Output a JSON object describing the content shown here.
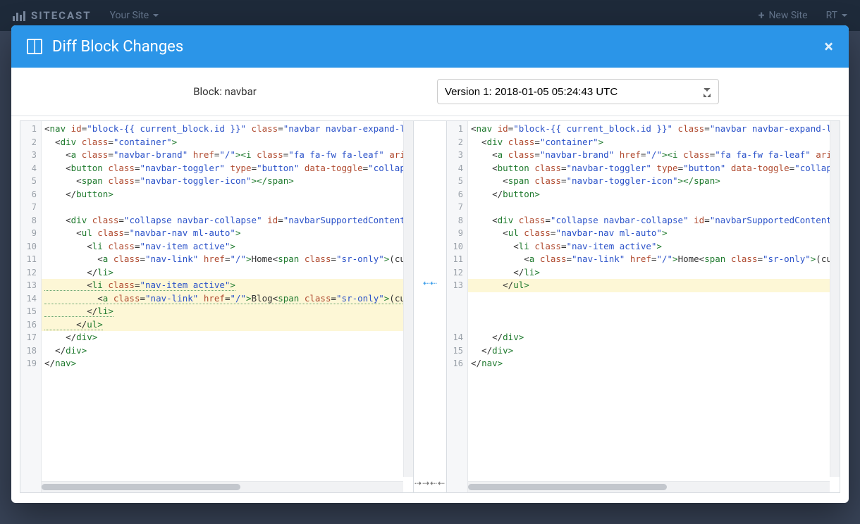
{
  "appbar": {
    "brand": "SITECAST",
    "your_site": "Your Site",
    "new_site": "New Site",
    "user": "RT"
  },
  "modal": {
    "title": "Diff Block Changes",
    "block_label": "Block: navbar",
    "version_selected": "Version 1: 2018-01-05 05:24:43 UTC"
  },
  "connector": {
    "mid": "⇠⇠",
    "bottom": "⇢⇢⇠⇠"
  },
  "left": {
    "lines": [
      {
        "n": "1",
        "hl": "",
        "tokens": [
          [
            "",
            "<"
          ],
          [
            "tag",
            "nav "
          ],
          [
            "attr",
            "id"
          ],
          [
            "",
            "="
          ],
          [
            "val",
            "\"block-{{ current_block.id }}\""
          ],
          [
            "",
            " "
          ],
          [
            "attr",
            "class"
          ],
          [
            "",
            "="
          ],
          [
            "val",
            "\"navbar navbar-expand-l"
          ]
        ]
      },
      {
        "n": "2",
        "hl": "",
        "tokens": [
          [
            "",
            "  <"
          ],
          [
            "tag",
            "div "
          ],
          [
            "attr",
            "class"
          ],
          [
            "",
            "="
          ],
          [
            "val",
            "\"container\""
          ],
          [
            "tag",
            ">"
          ]
        ]
      },
      {
        "n": "3",
        "hl": "",
        "tokens": [
          [
            "",
            "    <"
          ],
          [
            "tag",
            "a "
          ],
          [
            "attr",
            "class"
          ],
          [
            "",
            "="
          ],
          [
            "val",
            "\"navbar-brand\""
          ],
          [
            "",
            " "
          ],
          [
            "attr",
            "href"
          ],
          [
            "",
            "="
          ],
          [
            "val",
            "\"/\""
          ],
          [
            "tag",
            "><"
          ],
          [
            "tag",
            "i "
          ],
          [
            "attr",
            "class"
          ],
          [
            "",
            "="
          ],
          [
            "val",
            "\"fa fa-fw fa-leaf\""
          ],
          [
            "",
            " "
          ],
          [
            "attr",
            "ari"
          ]
        ]
      },
      {
        "n": "4",
        "hl": "",
        "tokens": [
          [
            "",
            "    <"
          ],
          [
            "tag",
            "button "
          ],
          [
            "attr",
            "class"
          ],
          [
            "",
            "="
          ],
          [
            "val",
            "\"navbar-toggler\""
          ],
          [
            "",
            " "
          ],
          [
            "attr",
            "type"
          ],
          [
            "",
            "="
          ],
          [
            "val",
            "\"button\""
          ],
          [
            "",
            " "
          ],
          [
            "attr",
            "data-toggle"
          ],
          [
            "",
            "="
          ],
          [
            "val",
            "\"collap"
          ]
        ]
      },
      {
        "n": "5",
        "hl": "",
        "tokens": [
          [
            "",
            "      <"
          ],
          [
            "tag",
            "span "
          ],
          [
            "attr",
            "class"
          ],
          [
            "",
            "="
          ],
          [
            "val",
            "\"navbar-toggler-icon\""
          ],
          [
            "tag",
            "></"
          ],
          [
            "tag",
            "span"
          ],
          [
            "tag",
            ">"
          ]
        ]
      },
      {
        "n": "6",
        "hl": "",
        "tokens": [
          [
            "",
            "    </"
          ],
          [
            "tag",
            "button"
          ],
          [
            "tag",
            ">"
          ]
        ]
      },
      {
        "n": "7",
        "hl": "",
        "tokens": [
          [
            "",
            ""
          ]
        ]
      },
      {
        "n": "8",
        "hl": "",
        "tokens": [
          [
            "",
            "    <"
          ],
          [
            "tag",
            "div "
          ],
          [
            "attr",
            "class"
          ],
          [
            "",
            "="
          ],
          [
            "val",
            "\"collapse navbar-collapse\""
          ],
          [
            "",
            " "
          ],
          [
            "attr",
            "id"
          ],
          [
            "",
            "="
          ],
          [
            "val",
            "\"navbarSupportedContent"
          ]
        ]
      },
      {
        "n": "9",
        "hl": "",
        "tokens": [
          [
            "",
            "      <"
          ],
          [
            "tag",
            "ul "
          ],
          [
            "attr",
            "class"
          ],
          [
            "",
            "="
          ],
          [
            "val",
            "\"navbar-nav ml-auto\""
          ],
          [
            "tag",
            ">"
          ]
        ]
      },
      {
        "n": "10",
        "hl": "",
        "tokens": [
          [
            "",
            "        <"
          ],
          [
            "tag",
            "li "
          ],
          [
            "attr",
            "class"
          ],
          [
            "",
            "="
          ],
          [
            "val",
            "\"nav-item active\""
          ],
          [
            "tag",
            ">"
          ]
        ]
      },
      {
        "n": "11",
        "hl": "",
        "tokens": [
          [
            "",
            "          <"
          ],
          [
            "tag",
            "a "
          ],
          [
            "attr",
            "class"
          ],
          [
            "",
            "="
          ],
          [
            "val",
            "\"nav-link\""
          ],
          [
            "",
            " "
          ],
          [
            "attr",
            "href"
          ],
          [
            "",
            "="
          ],
          [
            "val",
            "\"/\""
          ],
          [
            "tag",
            ">"
          ],
          [
            "",
            "Home<"
          ],
          [
            "tag",
            "span "
          ],
          [
            "attr",
            "class"
          ],
          [
            "",
            "="
          ],
          [
            "val",
            "\"sr-only\""
          ],
          [
            "tag",
            ">"
          ],
          [
            "",
            "(cu"
          ]
        ]
      },
      {
        "n": "12",
        "hl": "",
        "tokens": [
          [
            "",
            "        </"
          ],
          [
            "tag",
            "li"
          ],
          [
            "tag",
            ">"
          ]
        ]
      },
      {
        "n": "13",
        "hl": "change",
        "ins": true,
        "tokens": [
          [
            "",
            "        <"
          ],
          [
            "tag",
            "li "
          ],
          [
            "attr",
            "class"
          ],
          [
            "",
            "="
          ],
          [
            "val",
            "\"nav-item active\""
          ],
          [
            "tag",
            ">"
          ]
        ]
      },
      {
        "n": "14",
        "hl": "change",
        "ins": true,
        "tokens": [
          [
            "",
            "          <"
          ],
          [
            "tag",
            "a "
          ],
          [
            "attr",
            "class"
          ],
          [
            "",
            "="
          ],
          [
            "val",
            "\"nav-link\""
          ],
          [
            "",
            " "
          ],
          [
            "attr",
            "href"
          ],
          [
            "",
            "="
          ],
          [
            "val",
            "\"/\""
          ],
          [
            "tag",
            ">"
          ],
          [
            "",
            "Blog<"
          ],
          [
            "tag",
            "span "
          ],
          [
            "attr",
            "class"
          ],
          [
            "",
            "="
          ],
          [
            "val",
            "\"sr-only\""
          ],
          [
            "tag",
            ">"
          ],
          [
            "",
            "(cu"
          ]
        ]
      },
      {
        "n": "15",
        "hl": "change",
        "ins": true,
        "tokens": [
          [
            "",
            "        </"
          ],
          [
            "tag",
            "li"
          ],
          [
            "tag",
            ">"
          ]
        ]
      },
      {
        "n": "16",
        "hl": "change",
        "ins": true,
        "tokens": [
          [
            "",
            "      </"
          ],
          [
            "tag",
            "ul"
          ],
          [
            "tag",
            ">"
          ]
        ]
      },
      {
        "n": "17",
        "hl": "",
        "tokens": [
          [
            "",
            "    </"
          ],
          [
            "tag",
            "div"
          ],
          [
            "tag",
            ">"
          ]
        ]
      },
      {
        "n": "18",
        "hl": "",
        "tokens": [
          [
            "",
            "  </"
          ],
          [
            "tag",
            "div"
          ],
          [
            "tag",
            ">"
          ]
        ]
      },
      {
        "n": "19",
        "hl": "",
        "tokens": [
          [
            "",
            "</"
          ],
          [
            "tag",
            "nav"
          ],
          [
            "tag",
            ">"
          ]
        ]
      }
    ],
    "thumb_left": 0,
    "thumb_width": 55
  },
  "right": {
    "lines": [
      {
        "n": "1",
        "hl": "",
        "tokens": [
          [
            "",
            "<"
          ],
          [
            "tag",
            "nav "
          ],
          [
            "attr",
            "id"
          ],
          [
            "",
            "="
          ],
          [
            "val",
            "\"block-{{ current_block.id }}\""
          ],
          [
            "",
            " "
          ],
          [
            "attr",
            "class"
          ],
          [
            "",
            "="
          ],
          [
            "val",
            "\"navbar navbar-expand-l"
          ]
        ]
      },
      {
        "n": "2",
        "hl": "",
        "tokens": [
          [
            "",
            "  <"
          ],
          [
            "tag",
            "div "
          ],
          [
            "attr",
            "class"
          ],
          [
            "",
            "="
          ],
          [
            "val",
            "\"container\""
          ],
          [
            "tag",
            ">"
          ]
        ]
      },
      {
        "n": "3",
        "hl": "",
        "tokens": [
          [
            "",
            "    <"
          ],
          [
            "tag",
            "a "
          ],
          [
            "attr",
            "class"
          ],
          [
            "",
            "="
          ],
          [
            "val",
            "\"navbar-brand\""
          ],
          [
            "",
            " "
          ],
          [
            "attr",
            "href"
          ],
          [
            "",
            "="
          ],
          [
            "val",
            "\"/\""
          ],
          [
            "tag",
            "><"
          ],
          [
            "tag",
            "i "
          ],
          [
            "attr",
            "class"
          ],
          [
            "",
            "="
          ],
          [
            "val",
            "\"fa fa-fw fa-leaf\""
          ],
          [
            "",
            " "
          ],
          [
            "attr",
            "ari"
          ]
        ]
      },
      {
        "n": "4",
        "hl": "",
        "tokens": [
          [
            "",
            "    <"
          ],
          [
            "tag",
            "button "
          ],
          [
            "attr",
            "class"
          ],
          [
            "",
            "="
          ],
          [
            "val",
            "\"navbar-toggler\""
          ],
          [
            "",
            " "
          ],
          [
            "attr",
            "type"
          ],
          [
            "",
            "="
          ],
          [
            "val",
            "\"button\""
          ],
          [
            "",
            " "
          ],
          [
            "attr",
            "data-toggle"
          ],
          [
            "",
            "="
          ],
          [
            "val",
            "\"collap"
          ]
        ]
      },
      {
        "n": "5",
        "hl": "",
        "tokens": [
          [
            "",
            "      <"
          ],
          [
            "tag",
            "span "
          ],
          [
            "attr",
            "class"
          ],
          [
            "",
            "="
          ],
          [
            "val",
            "\"navbar-toggler-icon\""
          ],
          [
            "tag",
            "></"
          ],
          [
            "tag",
            "span"
          ],
          [
            "tag",
            ">"
          ]
        ]
      },
      {
        "n": "6",
        "hl": "",
        "tokens": [
          [
            "",
            "    </"
          ],
          [
            "tag",
            "button"
          ],
          [
            "tag",
            ">"
          ]
        ]
      },
      {
        "n": "7",
        "hl": "",
        "tokens": [
          [
            "",
            ""
          ]
        ]
      },
      {
        "n": "8",
        "hl": "",
        "tokens": [
          [
            "",
            "    <"
          ],
          [
            "tag",
            "div "
          ],
          [
            "attr",
            "class"
          ],
          [
            "",
            "="
          ],
          [
            "val",
            "\"collapse navbar-collapse\""
          ],
          [
            "",
            " "
          ],
          [
            "attr",
            "id"
          ],
          [
            "",
            "="
          ],
          [
            "val",
            "\"navbarSupportedContent"
          ]
        ]
      },
      {
        "n": "9",
        "hl": "",
        "tokens": [
          [
            "",
            "      <"
          ],
          [
            "tag",
            "ul "
          ],
          [
            "attr",
            "class"
          ],
          [
            "",
            "="
          ],
          [
            "val",
            "\"navbar-nav ml-auto\""
          ],
          [
            "tag",
            ">"
          ]
        ]
      },
      {
        "n": "10",
        "hl": "",
        "tokens": [
          [
            "",
            "        <"
          ],
          [
            "tag",
            "li "
          ],
          [
            "attr",
            "class"
          ],
          [
            "",
            "="
          ],
          [
            "val",
            "\"nav-item active\""
          ],
          [
            "tag",
            ">"
          ]
        ]
      },
      {
        "n": "11",
        "hl": "",
        "tokens": [
          [
            "",
            "          <"
          ],
          [
            "tag",
            "a "
          ],
          [
            "attr",
            "class"
          ],
          [
            "",
            "="
          ],
          [
            "val",
            "\"nav-link\""
          ],
          [
            "",
            " "
          ],
          [
            "attr",
            "href"
          ],
          [
            "",
            "="
          ],
          [
            "val",
            "\"/\""
          ],
          [
            "tag",
            ">"
          ],
          [
            "",
            "Home<"
          ],
          [
            "tag",
            "span "
          ],
          [
            "attr",
            "class"
          ],
          [
            "",
            "="
          ],
          [
            "val",
            "\"sr-only\""
          ],
          [
            "tag",
            ">"
          ],
          [
            "",
            "(cu"
          ]
        ]
      },
      {
        "n": "12",
        "hl": "",
        "tokens": [
          [
            "",
            "        </"
          ],
          [
            "tag",
            "li"
          ],
          [
            "tag",
            ">"
          ]
        ]
      },
      {
        "n": "13",
        "hl": "change",
        "tokens": [
          [
            "",
            "      </"
          ],
          [
            "tag",
            "ul"
          ],
          [
            "tag",
            ">"
          ]
        ]
      },
      {
        "n": "",
        "hl": "",
        "tokens": [
          [
            "",
            ""
          ]
        ]
      },
      {
        "n": "",
        "hl": "",
        "tokens": [
          [
            "",
            ""
          ]
        ]
      },
      {
        "n": "",
        "hl": "",
        "tokens": [
          [
            "",
            ""
          ]
        ]
      },
      {
        "n": "14",
        "hl": "",
        "tokens": [
          [
            "",
            "    </"
          ],
          [
            "tag",
            "div"
          ],
          [
            "tag",
            ">"
          ]
        ]
      },
      {
        "n": "15",
        "hl": "",
        "tokens": [
          [
            "",
            "  </"
          ],
          [
            "tag",
            "div"
          ],
          [
            "tag",
            ">"
          ]
        ]
      },
      {
        "n": "16",
        "hl": "",
        "tokens": [
          [
            "",
            "</"
          ],
          [
            "tag",
            "nav"
          ],
          [
            "tag",
            ">"
          ]
        ]
      }
    ],
    "thumb_left": 0,
    "thumb_width": 55
  }
}
